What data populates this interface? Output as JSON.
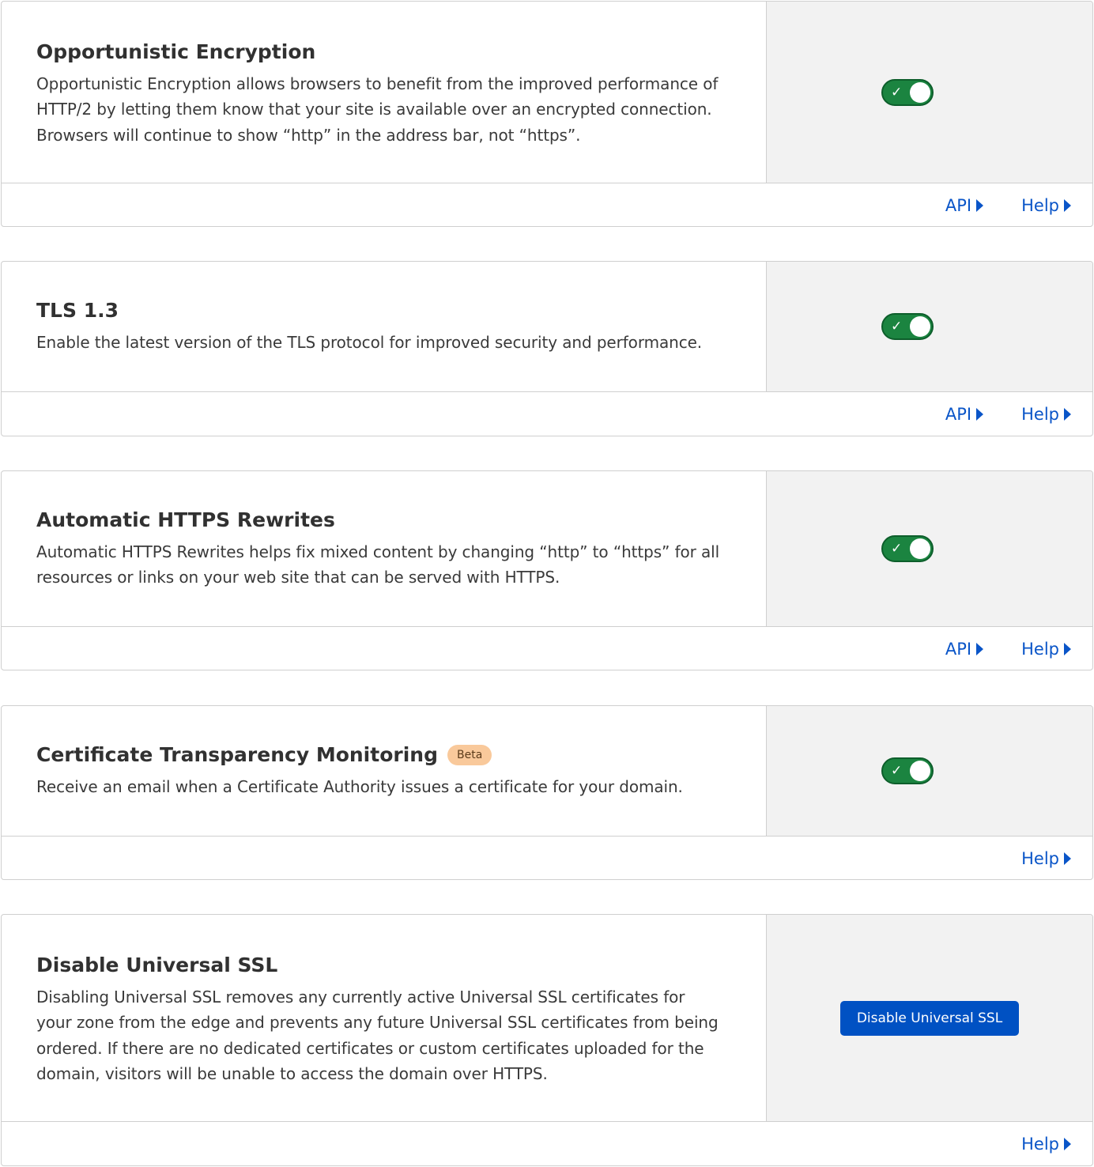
{
  "cards": [
    {
      "title": "Opportunistic Encryption",
      "description": "Opportunistic Encryption allows browsers to benefit from the improved performance of HTTP/2 by letting them know that your site is available over an encrypted connection. Browsers will continue to show “http” in the address bar, not “https”.",
      "toggle_state": "on",
      "api_label": "API",
      "help_label": "Help"
    },
    {
      "title": "TLS 1.3",
      "description": "Enable the latest version of the TLS protocol for improved security and performance.",
      "toggle_state": "on",
      "api_label": "API",
      "help_label": "Help"
    },
    {
      "title": "Automatic HTTPS Rewrites",
      "description": "Automatic HTTPS Rewrites helps fix mixed content by changing “http” to “https” for all resources or links on your web site that can be served with HTTPS.",
      "toggle_state": "on",
      "api_label": "API",
      "help_label": "Help"
    },
    {
      "title": "Certificate Transparency Monitoring",
      "badge": "Beta",
      "description": "Receive an email when a Certificate Authority issues a certificate for your domain.",
      "toggle_state": "on",
      "help_label": "Help"
    },
    {
      "title": "Disable Universal SSL",
      "description": "Disabling Universal SSL removes any currently active Universal SSL certificates for your zone from the edge and prevents any future Universal SSL certificates from being ordered. If there are no dedicated certificates or custom certificates uploaded for the domain, visitors will be unable to access the domain over HTTPS.",
      "button_label": "Disable Universal SSL",
      "help_label": "Help"
    }
  ],
  "colors": {
    "toggle_on": "#1b8440",
    "link": "#0a55c8",
    "primary_button": "#0051c3",
    "badge_bg": "#f9c99b",
    "panel_bg": "#f2f2f2"
  },
  "icons": {
    "toggle_check": "✓"
  }
}
